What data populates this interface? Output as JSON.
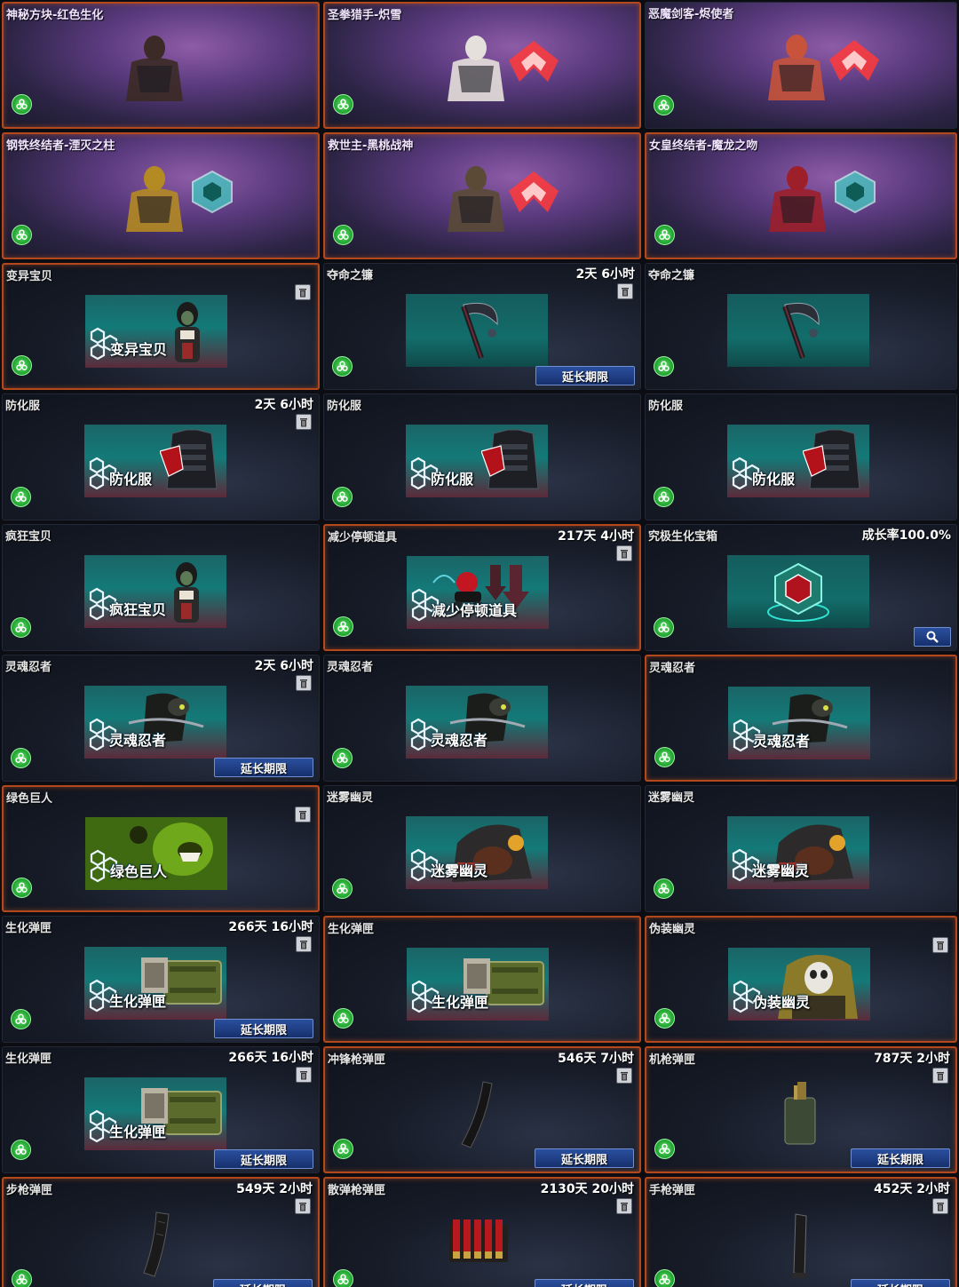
{
  "extend_label": "延长期限",
  "cards": [
    {
      "title": "神秘方块-红色生化",
      "time": "",
      "kind": "hero",
      "emblem": "",
      "hl": true,
      "trash": false,
      "label": "",
      "extend": false,
      "search": false
    },
    {
      "title": "圣拳猎手-炽雪",
      "time": "",
      "kind": "hero",
      "emblem": "red",
      "hl": true,
      "trash": false,
      "label": "",
      "extend": false,
      "search": false
    },
    {
      "title": "恶魔剑客-烬使者",
      "time": "",
      "kind": "hero",
      "emblem": "red",
      "hl": false,
      "trash": false,
      "label": "",
      "extend": false,
      "search": false
    },
    {
      "title": "钢铁终结者-湮灭之柱",
      "time": "",
      "kind": "hero",
      "emblem": "teal",
      "hl": true,
      "trash": false,
      "label": "",
      "extend": false,
      "search": false
    },
    {
      "title": "救世主-黑桃战神",
      "time": "",
      "kind": "hero",
      "emblem": "red",
      "hl": true,
      "trash": false,
      "label": "",
      "extend": false,
      "search": false
    },
    {
      "title": "女皇终结者-魔龙之吻",
      "time": "",
      "kind": "hero",
      "emblem": "teal",
      "hl": true,
      "trash": false,
      "label": "",
      "extend": false,
      "search": false
    },
    {
      "title": "变异宝贝",
      "time": "",
      "kind": "char",
      "hl": true,
      "trash": true,
      "label": "变异宝贝",
      "extend": false,
      "search": false
    },
    {
      "title": "夺命之镰",
      "time": "2天 6小时",
      "kind": "scythe",
      "hl": false,
      "trash": true,
      "label": "",
      "extend": true,
      "search": false
    },
    {
      "title": "夺命之镰",
      "time": "",
      "kind": "scythe",
      "hl": false,
      "trash": false,
      "label": "",
      "extend": false,
      "search": false
    },
    {
      "title": "防化服",
      "time": "2天 6小时",
      "kind": "armor",
      "hl": false,
      "trash": true,
      "label": "防化服",
      "extend": false,
      "search": false
    },
    {
      "title": "防化服",
      "time": "",
      "kind": "armor",
      "hl": false,
      "trash": false,
      "label": "防化服",
      "extend": false,
      "search": false
    },
    {
      "title": "防化服",
      "time": "",
      "kind": "armor",
      "hl": false,
      "trash": false,
      "label": "防化服",
      "extend": false,
      "search": false
    },
    {
      "title": "疯狂宝贝",
      "time": "",
      "kind": "char",
      "hl": false,
      "trash": false,
      "label": "疯狂宝贝",
      "extend": false,
      "search": false
    },
    {
      "title": "减少停顿道具",
      "time": "217天 4小时",
      "kind": "robot",
      "hl": true,
      "trash": true,
      "label": "减少停顿道具",
      "extend": false,
      "search": false
    },
    {
      "title": "究极生化宝箱",
      "time": "成长率100.0%",
      "kind": "box",
      "hl": false,
      "trash": false,
      "label": "",
      "extend": false,
      "search": true
    },
    {
      "title": "灵魂忍者",
      "time": "2天 6小时",
      "kind": "ninja",
      "hl": false,
      "trash": true,
      "label": "灵魂忍者",
      "extend": true,
      "search": false
    },
    {
      "title": "灵魂忍者",
      "time": "",
      "kind": "ninja",
      "hl": false,
      "trash": false,
      "label": "灵魂忍者",
      "extend": false,
      "search": false
    },
    {
      "title": "灵魂忍者",
      "time": "",
      "kind": "ninja",
      "hl": true,
      "trash": false,
      "label": "灵魂忍者",
      "extend": false,
      "search": false
    },
    {
      "title": "绿色巨人",
      "time": "",
      "kind": "giant",
      "hl": true,
      "trash": true,
      "label": "绿色巨人",
      "extend": false,
      "search": false
    },
    {
      "title": "迷雾幽灵",
      "time": "",
      "kind": "ghost",
      "hl": false,
      "trash": false,
      "label": "迷雾幽灵",
      "extend": false,
      "search": false
    },
    {
      "title": "迷雾幽灵",
      "time": "",
      "kind": "ghost",
      "hl": false,
      "trash": false,
      "label": "迷雾幽灵",
      "extend": false,
      "search": false
    },
    {
      "title": "生化弹匣",
      "time": "266天 16小时",
      "kind": "ammo",
      "hl": false,
      "trash": true,
      "label": "生化弹匣",
      "extend": true,
      "search": false
    },
    {
      "title": "生化弹匣",
      "time": "",
      "kind": "ammo",
      "hl": true,
      "trash": false,
      "label": "生化弹匣",
      "extend": false,
      "search": false
    },
    {
      "title": "伪装幽灵",
      "time": "",
      "kind": "disguise",
      "hl": true,
      "trash": true,
      "label": "伪装幽灵",
      "extend": false,
      "search": false
    },
    {
      "title": "生化弹匣",
      "time": "266天 16小时",
      "kind": "ammo",
      "hl": false,
      "trash": true,
      "label": "生化弹匣",
      "extend": true,
      "search": false
    },
    {
      "title": "冲锋枪弹匣",
      "time": "546天 7小时",
      "kind": "mag-curve",
      "hl": true,
      "trash": true,
      "label": "",
      "extend": true,
      "search": false
    },
    {
      "title": "机枪弹匣",
      "time": "787天 2小时",
      "kind": "mag-box",
      "hl": true,
      "trash": true,
      "label": "",
      "extend": true,
      "search": false
    },
    {
      "title": "步枪弹匣",
      "time": "549天 2小时",
      "kind": "mag-rifle",
      "hl": true,
      "trash": true,
      "label": "",
      "extend": true,
      "search": false
    },
    {
      "title": "散弹枪弹匣",
      "time": "2130天 20小时",
      "kind": "shells",
      "hl": true,
      "trash": true,
      "label": "",
      "extend": true,
      "search": false
    },
    {
      "title": "手枪弹匣",
      "time": "452天 2小时",
      "kind": "mag-pistol",
      "hl": true,
      "trash": true,
      "label": "",
      "extend": true,
      "search": false
    }
  ]
}
